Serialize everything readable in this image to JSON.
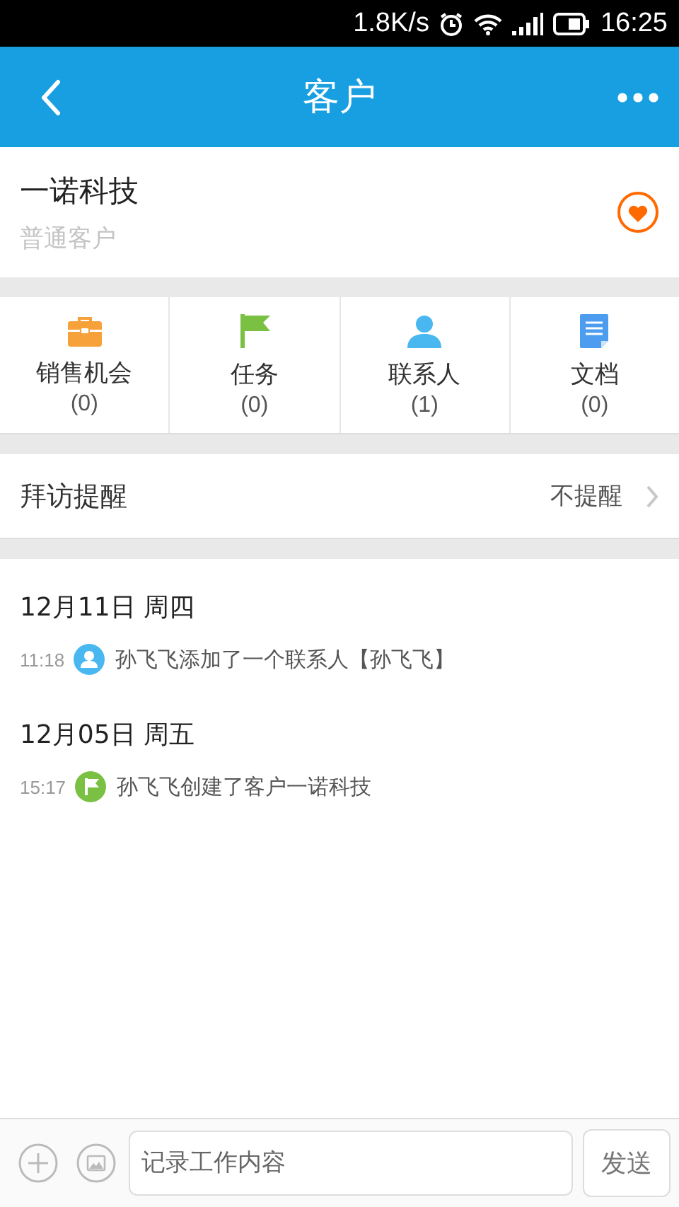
{
  "status_bar": {
    "speed": "1.8K/s",
    "time": "16:25"
  },
  "header": {
    "title": "客户"
  },
  "customer": {
    "name": "一诺科技",
    "type": "普通客户"
  },
  "tiles": [
    {
      "kind": "briefcase",
      "label": "销售机会",
      "count": "(0)"
    },
    {
      "kind": "flag",
      "label": "任务",
      "count": "(0)"
    },
    {
      "kind": "person",
      "label": "联系人",
      "count": "(1)"
    },
    {
      "kind": "document",
      "label": "文档",
      "count": "(0)"
    }
  ],
  "reminder": {
    "label": "拜访提醒",
    "value": "不提醒"
  },
  "timeline": [
    {
      "date": "12月11日 周四",
      "entries": [
        {
          "kind": "contact",
          "time": "11:18",
          "text": "孙飞飞添加了一个联系人【孙飞飞】"
        }
      ]
    },
    {
      "date": "12月05日 周五",
      "entries": [
        {
          "kind": "flag",
          "time": "15:17",
          "text": "孙飞飞创建了客户一诺科技"
        }
      ]
    }
  ],
  "composer": {
    "placeholder": "记录工作内容",
    "send": "发送"
  }
}
